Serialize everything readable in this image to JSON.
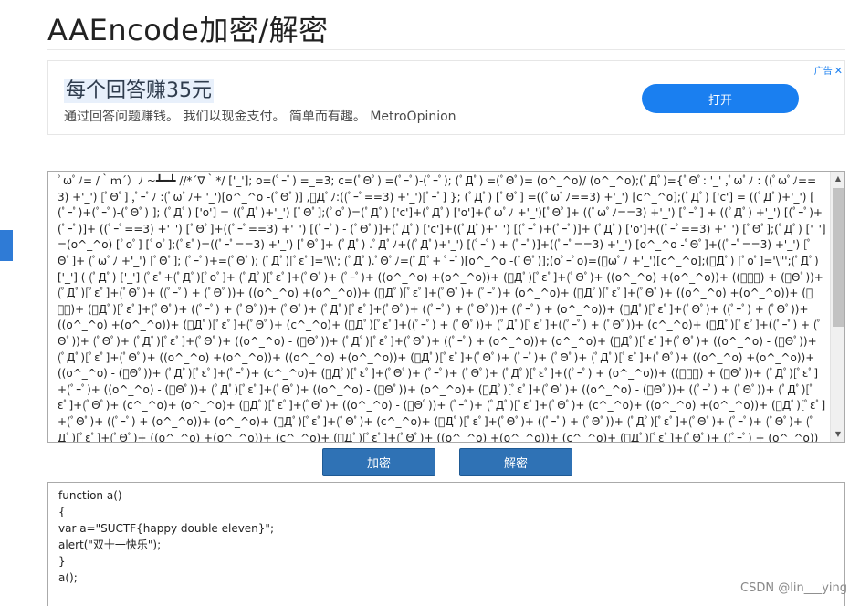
{
  "page": {
    "title": "AAEncode加密/解密"
  },
  "ad": {
    "headline": "每个回答赚35元",
    "subtitle": "通过回答问题赚钱。 我们以现金支付。 简单而有趣。 MetroOpinion",
    "button": "打开",
    "badge": "广告"
  },
  "encoded": {
    "text": "ﾟωﾟﾉ= /｀ｍ´）ﾉ ~┻━┻ //*´∇｀*/ ['_']; o=(ﾟｰﾟ) =_=3; c=(ﾟΘﾟ) =(ﾟｰﾟ)-(ﾟｰﾟ); (ﾟДﾟ) =(ﾟΘﾟ)= (o^_^o)/ (o^_^o);(ﾟДﾟ)={ﾟΘﾟ: '_' ,ﾟωﾟﾉ : ((ﾟωﾟﾉ==3) +'_') [ﾟΘﾟ] ,ﾟｰﾟﾉ :(ﾟωﾟﾉ+ '_')[o^_^o -(ﾟΘﾟ)] ,ﾟДﾟﾉ:((ﾟｰﾟ==3) +'_')[ﾟｰﾟ] }; (ﾟДﾟ) [ﾟΘﾟ] =((ﾟωﾟﾉ==3) +'_') [c^_^o];(ﾟДﾟ) ['c'] = ((ﾟДﾟ)+'_') [ (ﾟｰﾟ)+(ﾟｰﾟ)-(ﾟΘﾟ) ]; (ﾟДﾟ) ['o'] = ((ﾟДﾟ)+'_') [ﾟΘﾟ];(ﾟoﾟ)=(ﾟДﾟ) ['c']+(ﾟДﾟ) ['o']+(ﾟωﾟﾉ +'_')[ﾟΘﾟ]+ ((ﾟωﾟﾉ==3) +'_') [ﾟｰﾟ] + ((ﾟДﾟ) +'_') [(ﾟｰﾟ)+(ﾟｰﾟ)]+ ((ﾟｰﾟ==3) +'_') [ﾟΘﾟ]+((ﾟｰﾟ==3) +'_') [(ﾟｰﾟ) - (ﾟΘﾟ)]+(ﾟДﾟ) ['c']+((ﾟДﾟ)+'_') [(ﾟｰﾟ)+(ﾟｰﾟ)]+ (ﾟДﾟ) ['o']+((ﾟｰﾟ==3) +'_') [ﾟΘﾟ];(ﾟДﾟ) ['_'] =(o^_^o) [ﾟoﾟ] [ﾟoﾟ];(ﾟεﾟ)=((ﾟｰﾟ==3) +'_') [ﾟΘﾟ]+ (ﾟДﾟ) .ﾟДﾟﾉ+((ﾟДﾟ)+'_') [(ﾟｰﾟ) + (ﾟｰﾟ)]+((ﾟｰﾟ==3) +'_') [o^_^o -ﾟΘﾟ]+((ﾟｰﾟ==3) +'_') [ﾟΘﾟ]+ (ﾟωﾟﾉ +'_') [ﾟΘﾟ]; (ﾟｰﾟ)+=(ﾟΘﾟ); (ﾟДﾟ)[ﾟεﾟ]='\\\\'; (ﾟДﾟ).ﾟΘﾟﾉ=(ﾟДﾟ+ ﾟｰﾟ)[o^_^o -(ﾟΘﾟ)];(oﾟｰﾟo)=(ﾟωﾟﾉ +'_')[c^_^o];(ﾟДﾟ) [ﾟoﾟ]='\\\"';(ﾟДﾟ) ['_'] ( (ﾟДﾟ) ['_'] (ﾟεﾟ+(ﾟДﾟ)[ﾟoﾟ]+ (ﾟДﾟ)[ﾟεﾟ]+(ﾟΘﾟ)+ (ﾟｰﾟ)+ ((o^_^o) +(o^_^o))+ (ﾟДﾟ)[ﾟεﾟ]+(ﾟΘﾟ)+ ((o^_^o) +(o^_^o))+ ((ﾟｰﾟ) + (ﾟΘﾟ))+ (ﾟДﾟ)[ﾟεﾟ]+(ﾟΘﾟ)+ ((ﾟｰﾟ) + (ﾟΘﾟ))+ ((o^_^o) +(o^_^o))+ (ﾟДﾟ)[ﾟεﾟ]+(ﾟΘﾟ)+ (ﾟｰﾟ)+ (o^_^o)+ (ﾟДﾟ)[ﾟεﾟ]+(ﾟΘﾟ)+ ((o^_^o) +(o^_^o))+ (ﾟｰﾟ)+ (ﾟДﾟ)[ﾟεﾟ]+(ﾟΘﾟ)+ ((ﾟｰﾟ) + (ﾟΘﾟ))+ (ﾟΘﾟ)+ (ﾟДﾟ)[ﾟεﾟ]+(ﾟΘﾟ)+ ((ﾟｰﾟ) + (ﾟΘﾟ))+ ((ﾟｰﾟ) + (o^_^o))+ (ﾟДﾟ)[ﾟεﾟ]+(ﾟΘﾟ)+ ((ﾟｰﾟ) + (ﾟΘﾟ))+ ((o^_^o) +(o^_^o))+ (ﾟДﾟ)[ﾟεﾟ]+(ﾟΘﾟ)+ (c^_^o)+ (ﾟДﾟ)[ﾟεﾟ]+((ﾟｰﾟ) + (ﾟΘﾟ))+ (ﾟДﾟ)[ﾟεﾟ]+((ﾟｰﾟ) + (ﾟΘﾟ))+ (c^_^o)+ (ﾟДﾟ)[ﾟεﾟ]+((ﾟｰﾟ) + (ﾟΘﾟ))+ (ﾟΘﾟ)+ (ﾟДﾟ)[ﾟεﾟ]+(ﾟΘﾟ)+ ((o^_^o) - (ﾟΘﾟ))+ (ﾟДﾟ)[ﾟεﾟ]+(ﾟΘﾟ)+ ((ﾟｰﾟ) + (o^_^o))+ (o^_^o)+ (ﾟДﾟ)[ﾟεﾟ]+(ﾟΘﾟ)+ ((o^_^o) - (ﾟΘﾟ))+ (ﾟДﾟ)[ﾟεﾟ]+(ﾟΘﾟ)+ ((o^_^o) +(o^_^o))+ ((o^_^o) +(o^_^o))+ (ﾟДﾟ)[ﾟεﾟ]+(ﾟΘﾟ)+ (ﾟｰﾟ)+ (ﾟΘﾟ)+ (ﾟДﾟ)[ﾟεﾟ]+(ﾟΘﾟ)+ ((o^_^o) +(o^_^o))+ ((o^_^o) - (ﾟΘﾟ))+ (ﾟДﾟ)[ﾟεﾟ]+(ﾟｰﾟ)+ (c^_^o)+ (ﾟДﾟ)[ﾟεﾟ]+(ﾟΘﾟ)+ (ﾟｰﾟ)+ (ﾟΘﾟ)+ (ﾟДﾟ)[ﾟεﾟ]+((ﾟｰﾟ) + (o^_^o))+ ((ﾟｰﾟ) + (ﾟΘﾟ))+ (ﾟДﾟ)[ﾟεﾟ]+(ﾟｰﾟ)+ ((o^_^o) - (ﾟΘﾟ))+ (ﾟДﾟ)[ﾟεﾟ]+(ﾟΘﾟ)+ ((o^_^o) - (ﾟΘﾟ))+ (o^_^o)+ (ﾟДﾟ)[ﾟεﾟ]+(ﾟΘﾟ)+ ((o^_^o) - (ﾟΘﾟ))+ ((ﾟｰﾟ) + (ﾟΘﾟ))+ (ﾟДﾟ)[ﾟεﾟ]+(ﾟΘﾟ)+ (c^_^o)+ (o^_^o)+ (ﾟДﾟ)[ﾟεﾟ]+(ﾟΘﾟ)+ ((o^_^o) - (ﾟΘﾟ))+ (ﾟｰﾟ)+ (ﾟДﾟ)[ﾟεﾟ]+(ﾟΘﾟ)+ (c^_^o)+ ((o^_^o) +(o^_^o))+ (ﾟДﾟ)[ﾟεﾟ]+(ﾟΘﾟ)+ ((ﾟｰﾟ) + (o^_^o))+ (o^_^o)+ (ﾟДﾟ)[ﾟεﾟ]+(ﾟΘﾟ)+ (c^_^o)+ (ﾟДﾟ)[ﾟεﾟ]+(ﾟΘﾟ)+ ((ﾟｰﾟ) + (ﾟΘﾟ))+ (ﾟДﾟ)[ﾟεﾟ]+(ﾟΘﾟ)+ (ﾟｰﾟ)+ (ﾟΘﾟ)+ (ﾟДﾟ)[ﾟεﾟ]+(ﾟΘﾟ)+ ((o^_^o) +(o^_^o))+ (c^_^o)+ (ﾟДﾟ)[ﾟεﾟ]+(ﾟΘﾟ)+ ((o^_^o) +(o^_^o))+ (c^_^o)+ (ﾟДﾟ)[ﾟεﾟ]+(ﾟΘﾟ)+ ((ﾟｰﾟ) + (o^_^o))+ (ﾟΘﾟ)+ (ﾟДﾟ)[ﾟεﾟ]+(ﾟｰﾟ)+ (c^_^o)+ (ﾟДﾟ)[ﾟεﾟ]+(ﾟΘﾟ)+ (ﾟｰﾟ)+ (ﾟｰﾟ)+ (ﾟДﾟ)[ﾟεﾟ]+(ﾟΘﾟ)+ ((o^_^o) +(o^_^o))+ (ﾟΘﾟ)+ (ﾟДﾟ)[ﾟεﾟ]+(ﾟΘﾟ)+ ((o^_^o) +(o^_^o))+ (c^_^o)+ (ﾟДﾟ)[ﾟεﾟ]+(ﾟΘﾟ)+ ((ﾟｰﾟ) + (o^_^o))+ (ﾟΘﾟ)+ (ﾟДﾟ)[ﾟεﾟ]+(ﾟｰﾟ)+ (c^_^o)+ (ﾟДﾟ)[ﾟεﾟ]+(ﾟΘﾟ)+ (ﾟｰﾟ)+ (ﾟｰﾟ)+ (ﾟДﾟ)[ﾟεﾟ]+(ﾟΘﾟ)+ ((o^_^o) +(o^_^o))"
  },
  "actions": {
    "encrypt": "加密",
    "decrypt": "解密"
  },
  "result": {
    "lines": [
      "function a()",
      "{",
      "var a=\"SUCTF{happy double eleven}\";",
      "alert(\"双十一快乐\");",
      "}",
      "a();"
    ]
  },
  "watermark": "CSDN @lin___ying",
  "colors": {
    "accent": "#2f7bd6",
    "button": "#2f72b5",
    "ad_button": "#1a7ff0"
  }
}
